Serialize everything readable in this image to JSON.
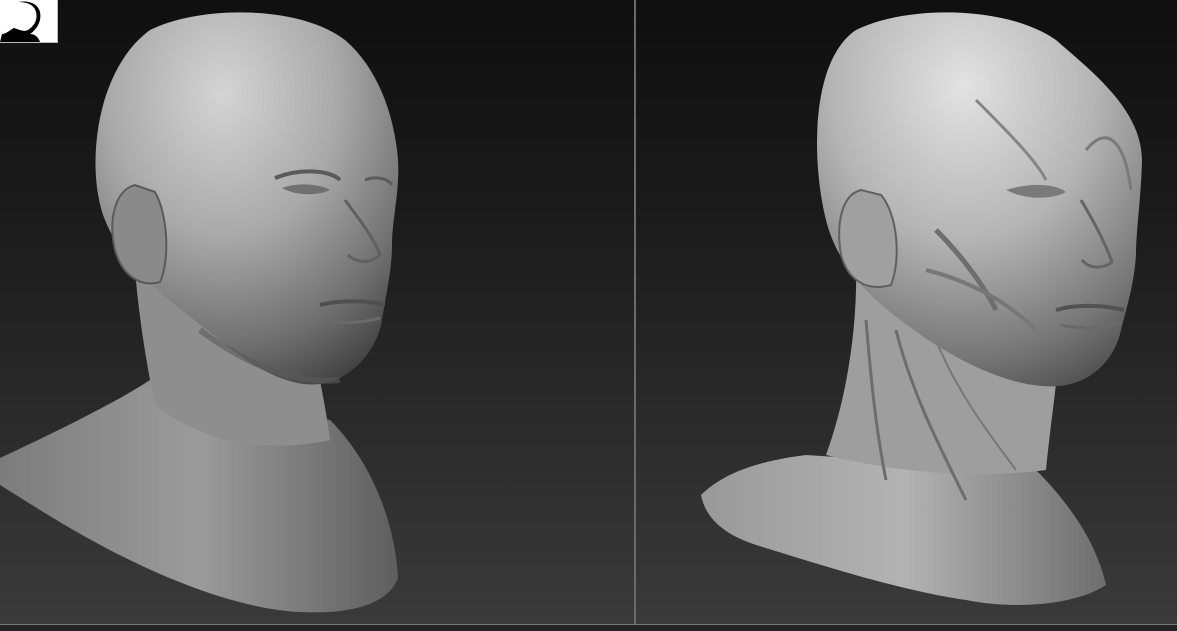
{
  "app": {
    "viewports": [
      {
        "model": "skin-head-bust"
      },
      {
        "model": "ecorche-head-bust"
      }
    ],
    "thumbnail": {
      "icon": "figure-silhouette-icon"
    },
    "colors": {
      "background_top": "#0f0f0f",
      "background_bottom": "#3a3a3a",
      "material": "#9a9a9a",
      "divider": "#6a6a6a"
    }
  }
}
